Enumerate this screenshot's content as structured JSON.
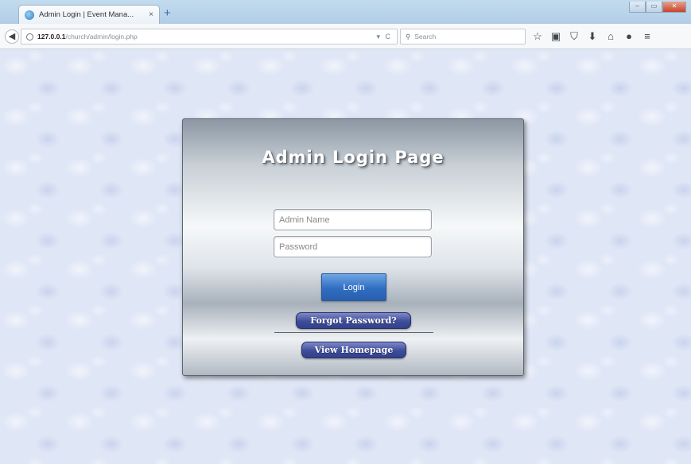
{
  "browser": {
    "tab_title": "Admin Login | Event Mana...",
    "tab_close": "×",
    "new_tab": "+",
    "url_host": "127.0.0.1",
    "url_path": "/church/admin/login.php",
    "url_actions": "▾ C",
    "search_placeholder": "Search",
    "window_controls": [
      "–",
      "▭",
      "✕"
    ],
    "toolbar_icons": [
      "star-icon",
      "clipboard-icon",
      "pocket-icon",
      "download-icon",
      "home-icon",
      "chat-icon",
      "menu-icon"
    ]
  },
  "login": {
    "title": "Admin Login Page",
    "admin_name_placeholder": "Admin Name",
    "password_placeholder": "Password",
    "login_label": "Login",
    "forgot_label": "Forgot Password?",
    "homepage_label": "View Homepage"
  },
  "colors": {
    "page_background": "#dfe6f6",
    "login_button": "#2f6dc2",
    "pill_button": "#3e4d9b"
  }
}
